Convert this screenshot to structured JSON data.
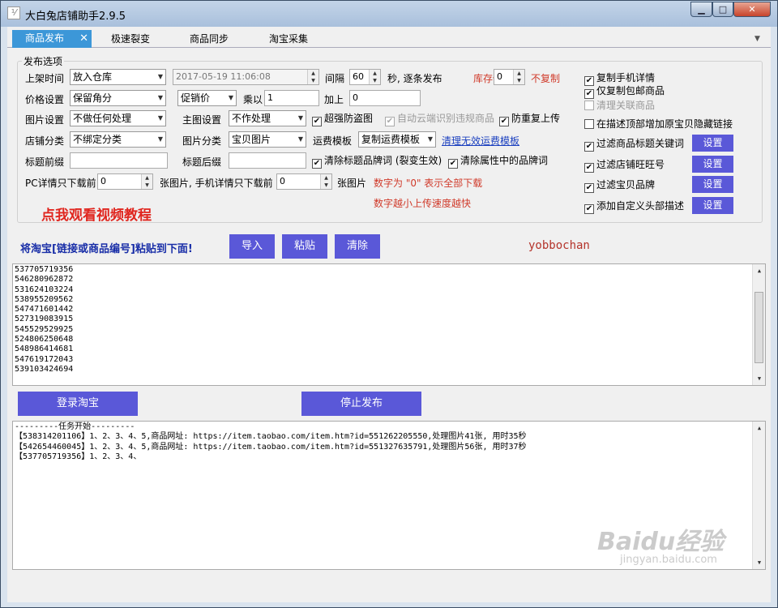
{
  "window": {
    "title": "大白兔店铺助手2.9.5",
    "min": "▁",
    "max": "□",
    "close": "✕"
  },
  "tabs": [
    "商品发布",
    "极速裂变",
    "商品同步",
    "淘宝采集"
  ],
  "options": {
    "group_title": "发布选项",
    "shelf_time_label": "上架时间",
    "shelf_time_value": "放入仓库",
    "datetime": "2017-05-19  11:06:08",
    "interval_label": "间隔",
    "interval_value": "60",
    "interval_unit": "秒, 逐条发布",
    "stock_low_label": "库存低于",
    "stock_low_value": "0",
    "no_copy_label": "不复制",
    "price_label": "价格设置",
    "price_value": "保留角分",
    "promo_value": "促销价",
    "multiply_label": "乘以",
    "multiply_value": "1",
    "add_label": "加上",
    "add_value": "0",
    "image_label": "图片设置",
    "image_value": "不做任何处理",
    "main_image_label": "主图设置",
    "main_image_value": "不作处理",
    "anti_theft": "超强防盗图",
    "auto_cloud": "自动云端识别违规商品",
    "prevent_dup": "防重复上传",
    "category_label": "店铺分类",
    "category_value": "不绑定分类",
    "img_category_label": "图片分类",
    "img_category_value": "宝贝图片",
    "freight_label": "运费模板",
    "freight_value": "复制运费模板",
    "clear_freight_link": "清理无效运费模板",
    "prefix_label": "标题前缀",
    "suffix_label": "标题后缀",
    "clear_brand_title": "清除标题品牌词 (裂变生效)",
    "clear_brand_attr": "清除属性中的品牌词",
    "pc_detail_label": "PC详情只下载前",
    "pc_detail_value": "0",
    "mobile_detail_label": "张图片, 手机详情只下载前",
    "mobile_detail_value": "0",
    "pic_unit": "张图片",
    "hint_zero": "数字为 \"0\" 表示全部下载",
    "hint_speed": "数字越小上传速度越快"
  },
  "right_options": [
    {
      "label": "复制手机详情",
      "checked": true,
      "disabled": false,
      "button": ""
    },
    {
      "label": "仅复制包邮商品",
      "checked": true,
      "disabled": false,
      "button": ""
    },
    {
      "label": "清理关联商品",
      "checked": false,
      "disabled": true,
      "button": ""
    },
    {
      "label": "在描述顶部增加原宝贝隐藏链接",
      "checked": false,
      "disabled": false,
      "button": ""
    },
    {
      "label": "过滤商品标题关键词",
      "checked": true,
      "disabled": false,
      "button": "设置"
    },
    {
      "label": "过滤店铺旺旺号",
      "checked": true,
      "disabled": false,
      "button": "设置"
    },
    {
      "label": "过滤宝贝品牌",
      "checked": true,
      "disabled": false,
      "button": "设置"
    },
    {
      "label": "添加自定义头部描述",
      "checked": true,
      "disabled": false,
      "button": "设置"
    }
  ],
  "video_link": "点我观看视频教程",
  "paste_hint": "将淘宝[链接或商品编号]粘贴到下面!",
  "buttons": {
    "import": "导入",
    "paste": "粘贴",
    "clear": "清除",
    "login": "登录淘宝",
    "stop": "停止发布"
  },
  "user_tag": "yobbochan",
  "item_ids": [
    "537705719356",
    "546280962872",
    "531624103224",
    "538955209562",
    "547471601442",
    "527319083915",
    "545529529925",
    "524806250648",
    "548986414681",
    "547619172043",
    "539103424694"
  ],
  "log": [
    "---------任务开始---------",
    "【538314201106】1、2、3、4、5,商品网址: https://item.taobao.com/item.htm?id=551262205550,处理图片41张, 用时35秒",
    "【542654460045】1、2、3、4、5,商品网址: https://item.taobao.com/item.htm?id=551327635791,处理图片56张, 用时37秒",
    "【537705719356】1、2、3、4、"
  ],
  "watermark": {
    "brand": "Baidu经验",
    "url": "jingyan.baidu.com"
  }
}
